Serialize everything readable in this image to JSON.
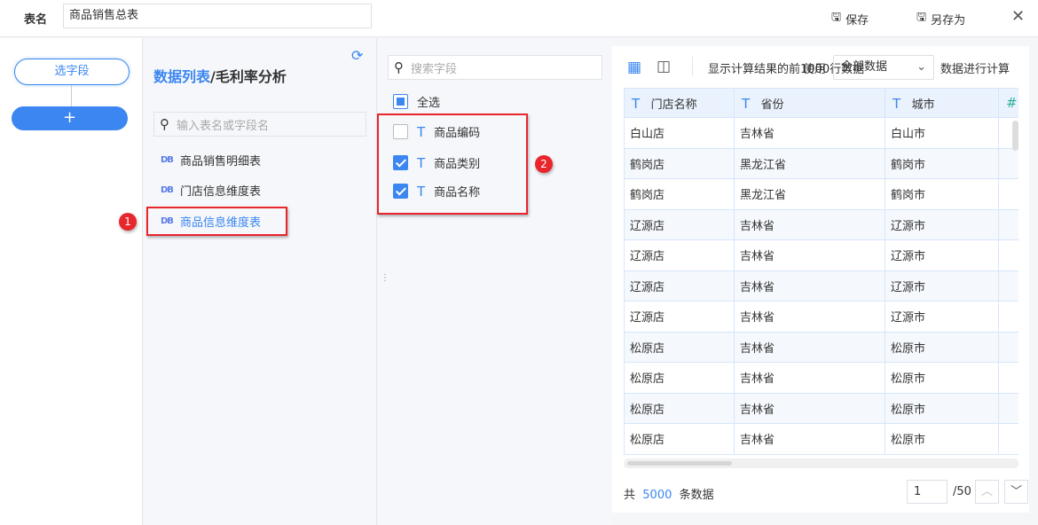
{
  "header": {
    "label": "表名",
    "table_name": "商品销售总表",
    "save": "保存",
    "save_as": "另存为"
  },
  "steps": {
    "select_fields": "选字段",
    "add": "+"
  },
  "tables": {
    "breadcrumb_root": "数据列表",
    "breadcrumb_current": "/毛利率分析",
    "search_placeholder": "输入表名或字段名",
    "items": [
      {
        "label": "商品销售明细表"
      },
      {
        "label": "门店信息维度表"
      },
      {
        "label": "商品信息维度表",
        "selected": true
      }
    ]
  },
  "fields": {
    "search_placeholder": "搜索字段",
    "select_all": "全选",
    "items": [
      {
        "label": "商品编码",
        "checked": false
      },
      {
        "label": "商品类别",
        "checked": true
      },
      {
        "label": "商品名称",
        "checked": true
      }
    ]
  },
  "annotations": [
    "1",
    "2"
  ],
  "preview": {
    "toolbar_text": "显示计算结果的前1000行数据",
    "use_label": "使用",
    "select_value": "全部数据",
    "suffix": "数据进行计算",
    "columns": [
      "门店名称",
      "省份",
      "城市"
    ],
    "rows": [
      [
        "白山店",
        "吉林省",
        "白山市"
      ],
      [
        "鹤岗店",
        "黑龙江省",
        "鹤岗市"
      ],
      [
        "鹤岗店",
        "黑龙江省",
        "鹤岗市"
      ],
      [
        "辽源店",
        "吉林省",
        "辽源市"
      ],
      [
        "辽源店",
        "吉林省",
        "辽源市"
      ],
      [
        "辽源店",
        "吉林省",
        "辽源市"
      ],
      [
        "辽源店",
        "吉林省",
        "辽源市"
      ],
      [
        "松原店",
        "吉林省",
        "松原市"
      ],
      [
        "松原店",
        "吉林省",
        "松原市"
      ],
      [
        "松原店",
        "吉林省",
        "松原市"
      ],
      [
        "松原店",
        "吉林省",
        "松原市"
      ]
    ],
    "total_prefix": "共",
    "total": "5000",
    "total_suffix": "条数据",
    "page": "1",
    "pages": "/50"
  },
  "colors": {
    "accent": "#3b86f0",
    "annotation": "#e8262b"
  }
}
